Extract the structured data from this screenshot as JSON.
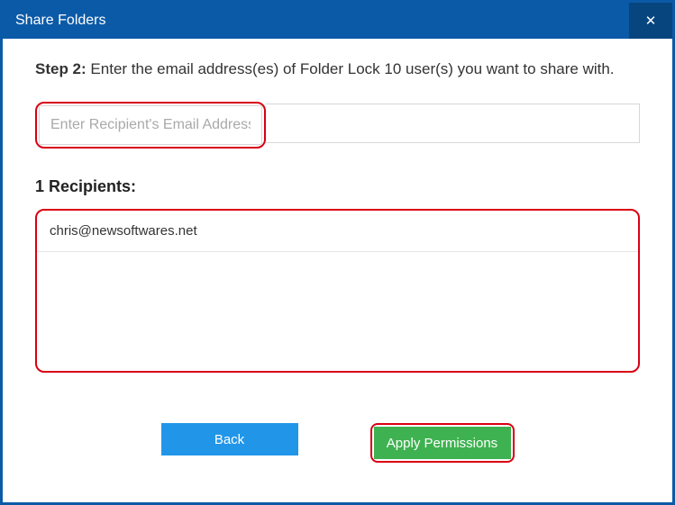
{
  "titlebar": {
    "title": "Share Folders"
  },
  "step": {
    "label": "Step 2:",
    "text": "Enter the email address(es) of Folder Lock 10 user(s) you want to share with."
  },
  "emailInput": {
    "placeholder": "Enter Recipient's Email Address",
    "value": ""
  },
  "recipientsLabel": "1 Recipients:",
  "recipients": [
    {
      "email": "chris@newsoftwares.net"
    }
  ],
  "buttons": {
    "back": "Back",
    "apply": "Apply Permissions"
  }
}
